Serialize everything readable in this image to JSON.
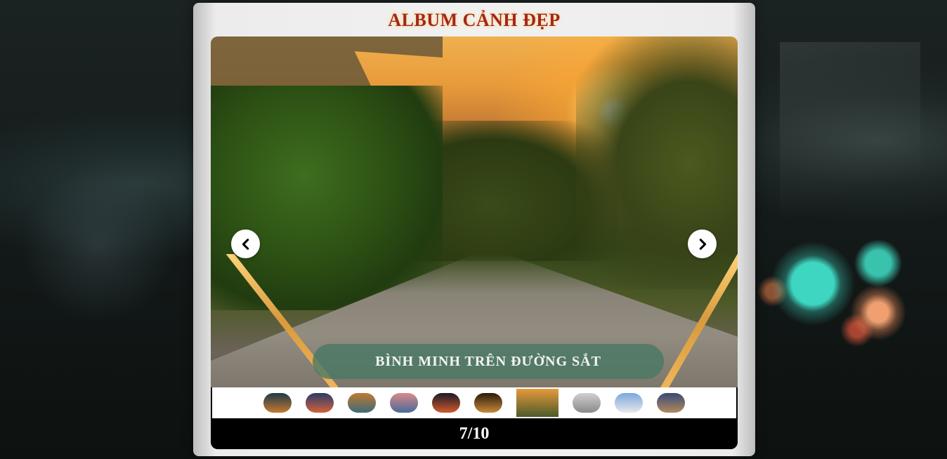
{
  "album": {
    "title": "ALBUM CẢNH ĐẸP"
  },
  "slide": {
    "caption": "BÌNH MINH TRÊN ĐƯỜNG SẮT",
    "image_icon": "sunrise-railway-photo"
  },
  "navigation": {
    "prev_icon": "chevron-left-icon",
    "next_icon": "chevron-right-icon"
  },
  "thumbnails": [
    {
      "name": "night-road",
      "colors": [
        "#1e3a4a",
        "#c47a30"
      ]
    },
    {
      "name": "dusk-mountain",
      "colors": [
        "#2a3a6a",
        "#d2623a"
      ]
    },
    {
      "name": "lake-sunset",
      "colors": [
        "#c07a30",
        "#3e6a7a"
      ]
    },
    {
      "name": "pink-sky",
      "colors": [
        "#d88a8a",
        "#4a6a9a"
      ]
    },
    {
      "name": "city-lights",
      "colors": [
        "#1a1a2a",
        "#d25a2a"
      ]
    },
    {
      "name": "golden-tunnel",
      "colors": [
        "#2a1a0a",
        "#c88a3a"
      ]
    },
    {
      "name": "railway-sunrise",
      "colors": [
        "#e89a3a",
        "#4a5a2a"
      ],
      "active": true
    },
    {
      "name": "arch-monument",
      "colors": [
        "#cfcfcf",
        "#8a8a8a"
      ]
    },
    {
      "name": "leaning-tower",
      "colors": [
        "#7aa8e0",
        "#e8e8e8"
      ]
    },
    {
      "name": "cathedral-dusk",
      "colors": [
        "#3a4a7a",
        "#b08a5a"
      ]
    }
  ],
  "counter": {
    "text": "7/10",
    "current": 7,
    "total": 10
  }
}
